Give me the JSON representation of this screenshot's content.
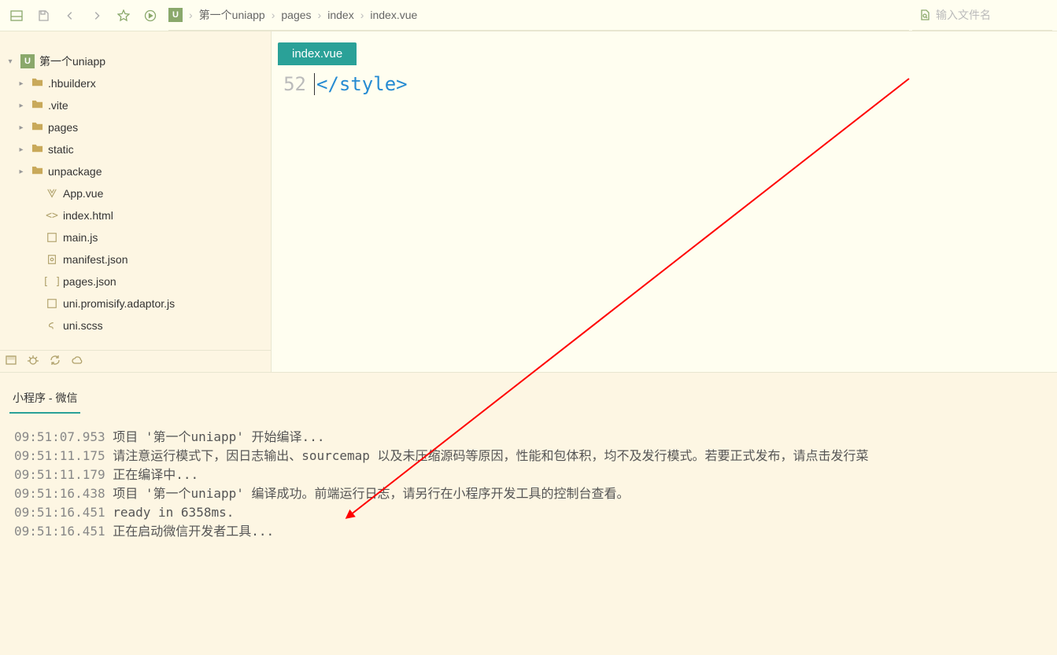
{
  "toolbar": {
    "search_placeholder": "输入文件名"
  },
  "breadcrumb": [
    "第一个uniapp",
    "pages",
    "index",
    "index.vue"
  ],
  "project": {
    "name": "第一个uniapp",
    "children": [
      {
        "type": "folder",
        "name": ".hbuilderx"
      },
      {
        "type": "folder",
        "name": ".vite"
      },
      {
        "type": "folder",
        "name": "pages"
      },
      {
        "type": "folder",
        "name": "static"
      },
      {
        "type": "folder",
        "name": "unpackage"
      },
      {
        "type": "file",
        "name": "App.vue",
        "icon": "vue"
      },
      {
        "type": "file",
        "name": "index.html",
        "icon": "html"
      },
      {
        "type": "file",
        "name": "main.js",
        "icon": "js"
      },
      {
        "type": "file",
        "name": "manifest.json",
        "icon": "json"
      },
      {
        "type": "file",
        "name": "pages.json",
        "icon": "json2"
      },
      {
        "type": "file",
        "name": "uni.promisify.adaptor.js",
        "icon": "js"
      },
      {
        "type": "file",
        "name": "uni.scss",
        "icon": "scss"
      }
    ]
  },
  "editor": {
    "active_tab": "index.vue",
    "line_no": "52",
    "line_code": "</style>"
  },
  "console": {
    "tab": "小程序 - 微信",
    "lines": [
      {
        "ts": "09:51:07.953",
        "msg": "项目 '第一个uniapp' 开始编译..."
      },
      {
        "ts": "09:51:11.175",
        "msg": "请注意运行模式下，因日志输出、sourcemap 以及未压缩源码等原因，性能和包体积，均不及发行模式。若要正式发布，请点击发行菜"
      },
      {
        "ts": "09:51:11.179",
        "msg": "正在编译中..."
      },
      {
        "ts": "09:51:16.438",
        "msg": "项目 '第一个uniapp' 编译成功。前端运行日志，请另行在小程序开发工具的控制台查看。"
      },
      {
        "ts": "09:51:16.451",
        "msg": "ready in 6358ms."
      },
      {
        "ts": "09:51:16.451",
        "msg": "正在启动微信开发者工具..."
      }
    ]
  }
}
